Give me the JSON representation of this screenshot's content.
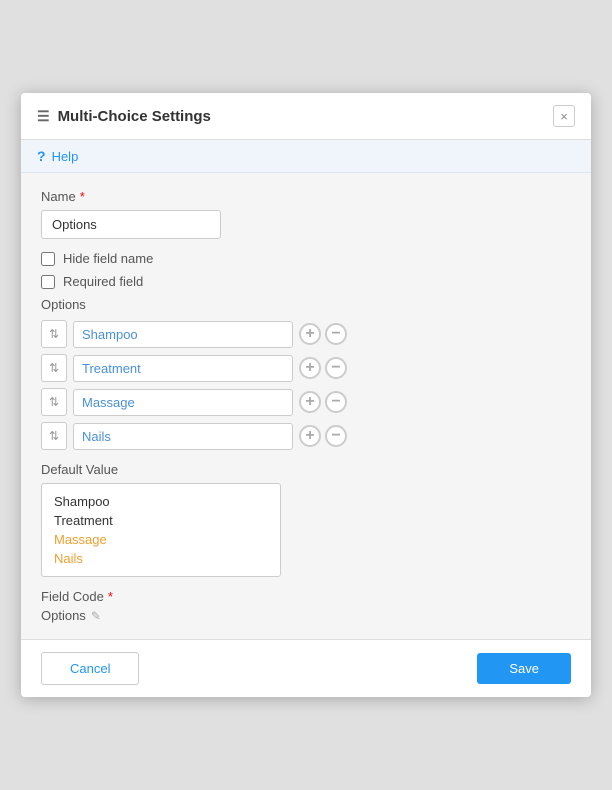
{
  "dialog": {
    "title": "Multi-Choice Settings",
    "title_icon": "☰",
    "close_label": "×",
    "help_label": "Help",
    "name_label": "Name",
    "name_value": "Options",
    "hide_field_name_label": "Hide field name",
    "required_field_label": "Required field",
    "options_label": "Options",
    "options": [
      {
        "value": "Shampoo"
      },
      {
        "value": "Treatment"
      },
      {
        "value": "Massage"
      },
      {
        "value": "Nails"
      }
    ],
    "default_value_label": "Default Value",
    "default_value_items": [
      {
        "label": "Shampoo",
        "style": "normal"
      },
      {
        "label": "Treatment",
        "style": "normal"
      },
      {
        "label": "Massage",
        "style": "orange"
      },
      {
        "label": "Nails",
        "style": "orange"
      }
    ],
    "field_code_label": "Field Code",
    "field_code_value": "Options",
    "cancel_label": "Cancel",
    "save_label": "Save"
  }
}
